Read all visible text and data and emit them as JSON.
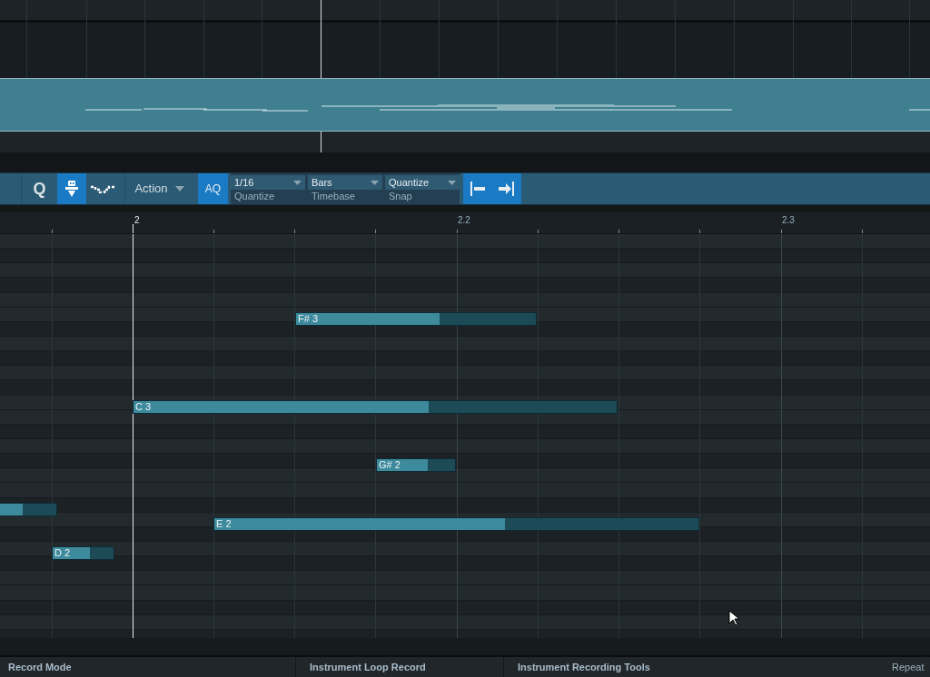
{
  "toolbar": {
    "quantize_button": {
      "label": "Q"
    },
    "action_menu": {
      "label": "Action"
    },
    "auto_quantize": {
      "label": "AQ",
      "on": true
    },
    "tool_toggle": {
      "on": true
    },
    "dropdowns": [
      {
        "value": "1/16",
        "caption": "Quantize"
      },
      {
        "value": "Bars",
        "caption": "Timebase"
      },
      {
        "value": "Quantize",
        "caption": "Snap"
      }
    ]
  },
  "ruler": {
    "marks": [
      "2",
      "2.2",
      "2.3"
    ]
  },
  "notes": [
    {
      "label": "F# 3",
      "level": 0.6
    },
    {
      "label": "C 3",
      "level": 0.61
    },
    {
      "label": "G# 2",
      "level": 0.65
    },
    {
      "level": 0.41
    },
    {
      "label": "E 2",
      "level": 0.6
    },
    {
      "label": "D 2",
      "level": 0.61
    }
  ],
  "status_bar": [
    "Record Mode",
    "Instrument Loop Record",
    "Instrument Recording Tools",
    "Repeat"
  ]
}
